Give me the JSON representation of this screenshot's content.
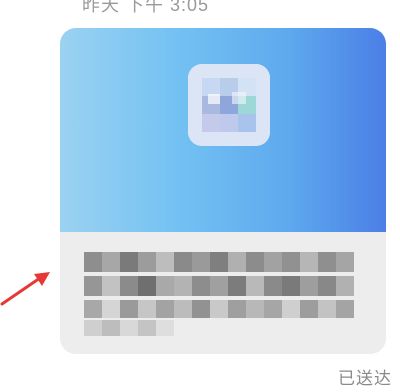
{
  "chat": {
    "timestamp": "昨天 下午 3:05",
    "status": "已送达"
  },
  "card": {
    "banner_gradient": [
      "#9bd2f1",
      "#74c2f3",
      "#5ea9ee",
      "#4b7fe6"
    ],
    "icon_name": "app-icon",
    "body_text_redacted": true
  },
  "annotation": {
    "arrow_color": "#e53935",
    "arrow_icon": "pointer-arrow-icon"
  }
}
